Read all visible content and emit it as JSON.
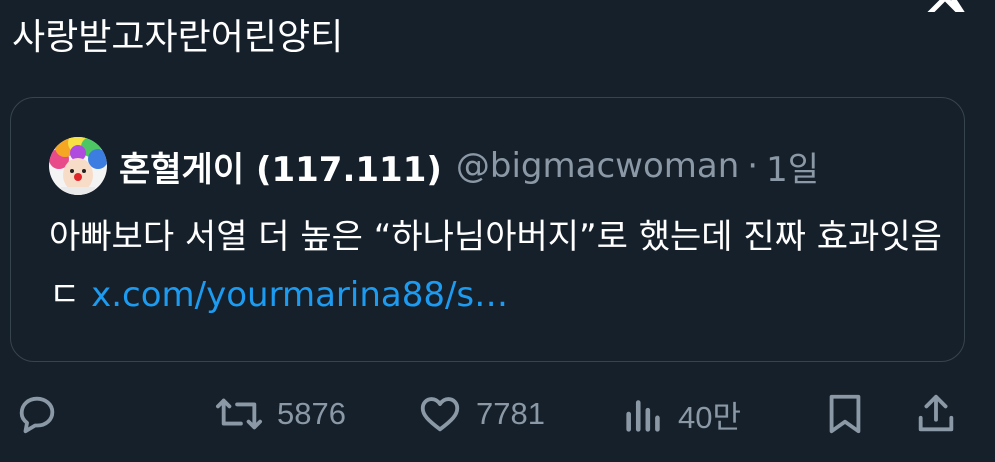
{
  "tweet": {
    "text": "사랑받고자란어린양티"
  },
  "quote": {
    "display_name": "혼혈게이 (117.111)",
    "handle": "@bigmacwoman",
    "separator": "·",
    "time": "1일",
    "text": "아빠보다 서열 더 높은 “하나님아버지”로 했는데 진짜 효과잇음 ㄷ ",
    "link": "x.com/yourmarina88/s…"
  },
  "actions": {
    "reply_icon": "reply-icon",
    "retweet_icon": "retweet-icon",
    "retweet_count": "5876",
    "like_icon": "heart-icon",
    "like_count": "7781",
    "views_icon": "views-icon",
    "views_count": "40만",
    "bookmark_icon": "bookmark-icon",
    "share_icon": "share-icon"
  },
  "colors": {
    "background": "#15202b",
    "border": "#38444d",
    "secondary_text": "#8b98a5",
    "link": "#1d9bf0"
  }
}
